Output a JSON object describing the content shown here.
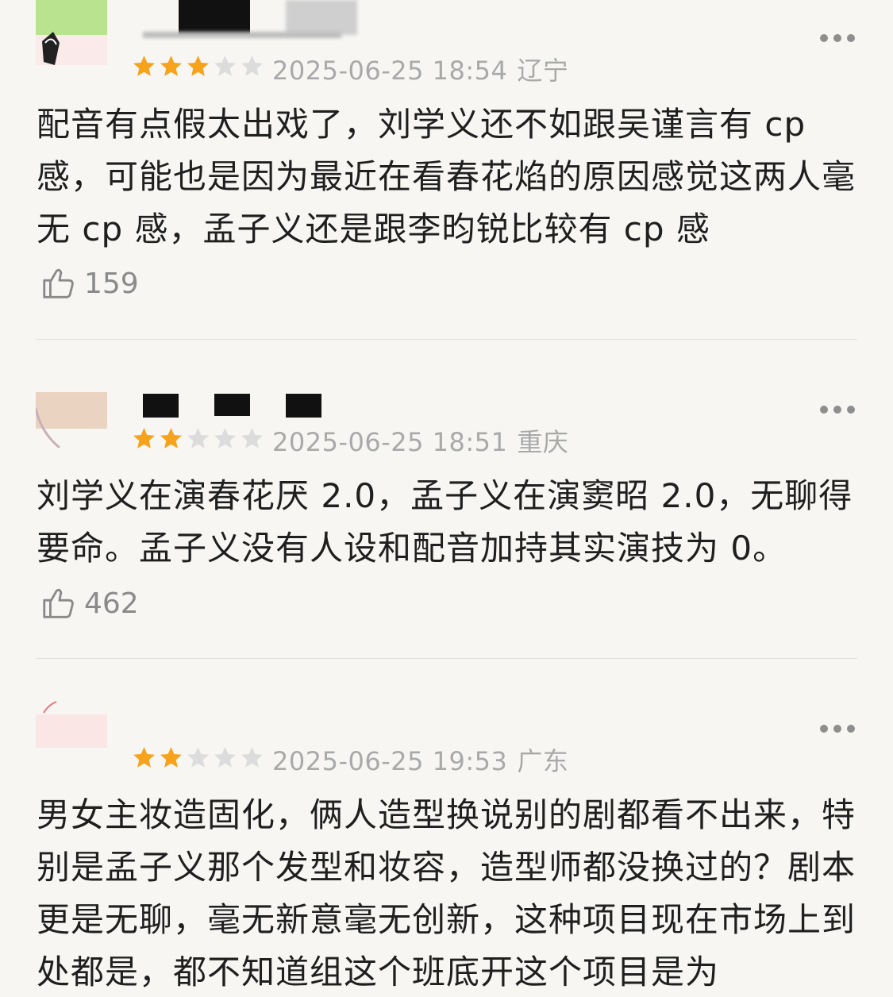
{
  "reviews": [
    {
      "date": "2025-06-25 18:54",
      "location": "辽宁",
      "rating": 3,
      "text": "配音有点假太出戏了，刘学义还不如跟吴谨言有 cp 感，可能也是因为最近在看春花焰的原因感觉这两人毫无 cp 感，孟子义还是跟李昀锐比较有 cp 感",
      "likes": "159"
    },
    {
      "date": "2025-06-25 18:51",
      "location": "重庆",
      "rating": 2,
      "text": "刘学义在演春花厌 2.0，孟子义在演窦昭 2.0，无聊得要命。孟子义没有人设和配音加持其实演技为 0。",
      "likes": "462"
    },
    {
      "date": "2025-06-25 19:53",
      "location": "广东",
      "rating": 2,
      "text": "男女主妆造固化，俩人造型换说别的剧都看不出来，特别是孟子义那个发型和妆容，造型师都没换过的？剧本更是无聊，毫无新意毫无创新，这种项目现在市场上到处都是，都不知道组这个班底开这个项目是为",
      "likes": ""
    }
  ],
  "colors": {
    "star_filled": "#f7a21b",
    "star_empty": "#dcdcdc",
    "meta_text": "#a9a9a9",
    "background": "#f7f6f2"
  },
  "icons": {
    "more": "more-dots-icon",
    "like": "thumbs-up-icon",
    "star": "star-icon"
  }
}
